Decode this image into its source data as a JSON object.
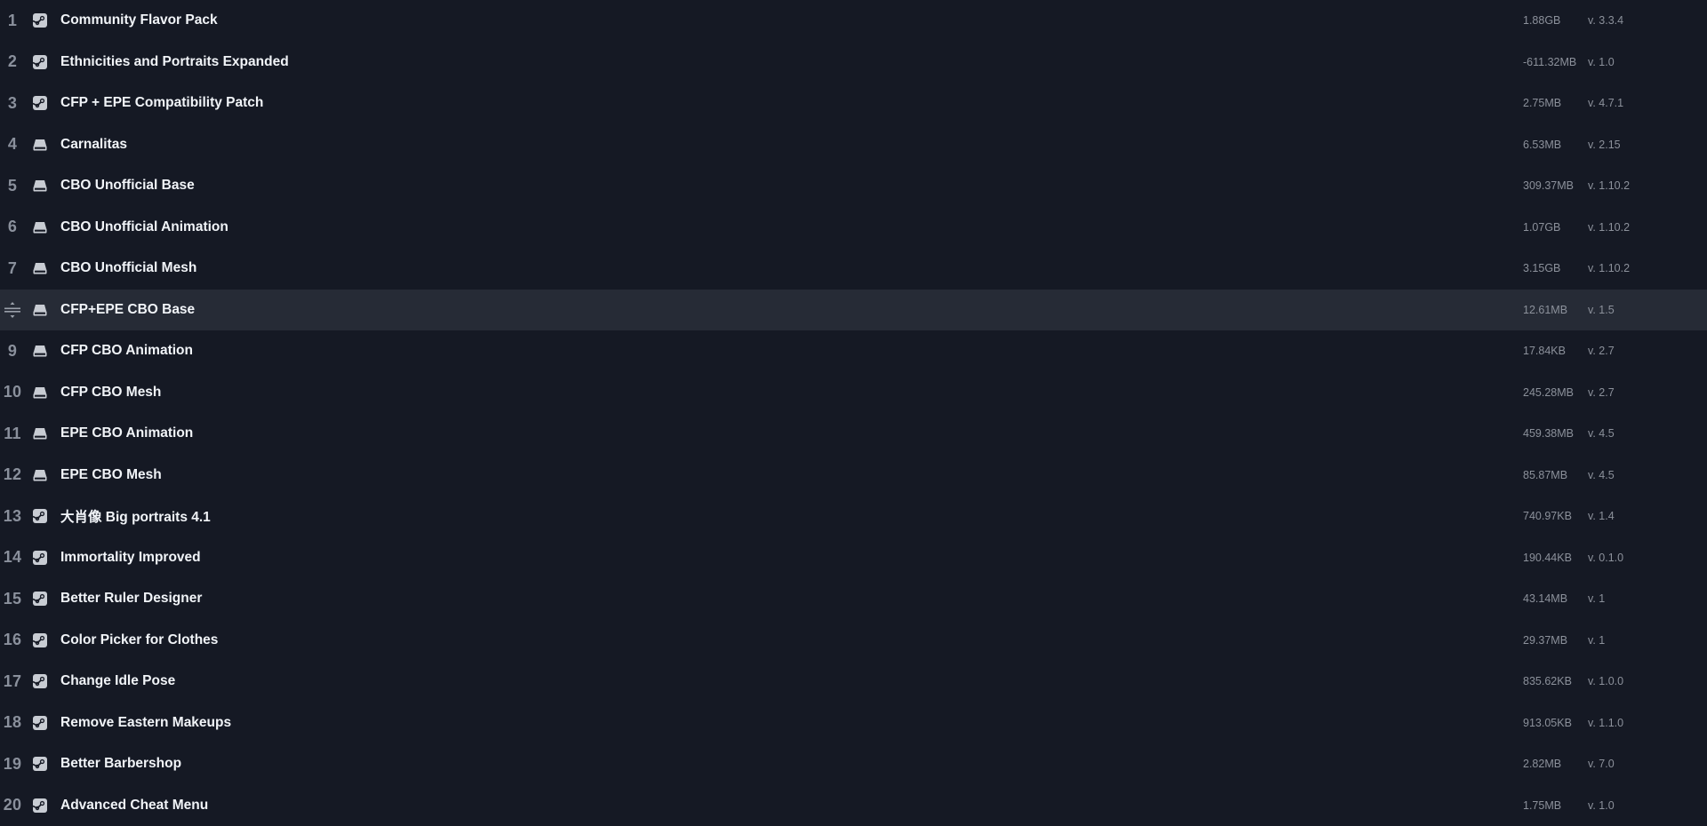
{
  "mods": [
    {
      "index": "1",
      "source": "steam-icon",
      "name": "Community Flavor Pack",
      "size": "1.88GB",
      "version": "v. 3.3.4",
      "selected": false
    },
    {
      "index": "2",
      "source": "steam-icon",
      "name": "Ethnicities and Portraits Expanded",
      "size": "-611.32MB",
      "version": "v. 1.0",
      "selected": false
    },
    {
      "index": "3",
      "source": "steam-icon",
      "name": "CFP + EPE Compatibility Patch",
      "size": "2.75MB",
      "version": "v. 4.7.1",
      "selected": false
    },
    {
      "index": "4",
      "source": "local-drive-icon",
      "name": "Carnalitas",
      "size": "6.53MB",
      "version": "v. 2.15",
      "selected": false
    },
    {
      "index": "5",
      "source": "local-drive-icon",
      "name": "CBO Unofficial Base",
      "size": "309.37MB",
      "version": "v. 1.10.2",
      "selected": false
    },
    {
      "index": "6",
      "source": "local-drive-icon",
      "name": "CBO Unofficial Animation",
      "size": "1.07GB",
      "version": "v. 1.10.2",
      "selected": false
    },
    {
      "index": "7",
      "source": "local-drive-icon",
      "name": "CBO Unofficial Mesh",
      "size": "3.15GB",
      "version": "v. 1.10.2",
      "selected": false
    },
    {
      "index": "",
      "source": "local-drive-icon",
      "name": "CFP+EPE CBO Base",
      "size": "12.61MB",
      "version": "v. 1.5",
      "selected": true
    },
    {
      "index": "9",
      "source": "local-drive-icon",
      "name": "CFP CBO Animation",
      "size": "17.84KB",
      "version": "v. 2.7",
      "selected": false
    },
    {
      "index": "10",
      "source": "local-drive-icon",
      "name": "CFP CBO Mesh",
      "size": "245.28MB",
      "version": "v. 2.7",
      "selected": false
    },
    {
      "index": "11",
      "source": "local-drive-icon",
      "name": "EPE CBO Animation",
      "size": "459.38MB",
      "version": "v. 4.5",
      "selected": false
    },
    {
      "index": "12",
      "source": "local-drive-icon",
      "name": "EPE CBO Mesh",
      "size": "85.87MB",
      "version": "v. 4.5",
      "selected": false
    },
    {
      "index": "13",
      "source": "steam-icon",
      "name": "大肖像 Big portraits 4.1",
      "size": "740.97KB",
      "version": "v. 1.4",
      "selected": false
    },
    {
      "index": "14",
      "source": "steam-icon",
      "name": "Immortality Improved",
      "size": "190.44KB",
      "version": "v. 0.1.0",
      "selected": false
    },
    {
      "index": "15",
      "source": "steam-icon",
      "name": "Better Ruler Designer",
      "size": "43.14MB",
      "version": "v. 1",
      "selected": false
    },
    {
      "index": "16",
      "source": "steam-icon",
      "name": "Color Picker for Clothes",
      "size": "29.37MB",
      "version": "v. 1",
      "selected": false
    },
    {
      "index": "17",
      "source": "steam-icon",
      "name": "Change Idle Pose",
      "size": "835.62KB",
      "version": "v. 1.0.0",
      "selected": false
    },
    {
      "index": "18",
      "source": "steam-icon",
      "name": "Remove Eastern Makeups",
      "size": "913.05KB",
      "version": "v. 1.1.0",
      "selected": false
    },
    {
      "index": "19",
      "source": "steam-icon",
      "name": "Better Barbershop",
      "size": "2.82MB",
      "version": "v. 7.0",
      "selected": false
    },
    {
      "index": "20",
      "source": "steam-icon",
      "name": "Advanced Cheat Menu",
      "size": "1.75MB",
      "version": "v. 1.0",
      "selected": false
    }
  ],
  "colors": {
    "background": "#151924",
    "selected_row": "#262b36",
    "name_text": "#f1f4f8",
    "meta_text": "#8c919b",
    "index_text": "#8a909c",
    "icon": "#c8ccd3"
  }
}
